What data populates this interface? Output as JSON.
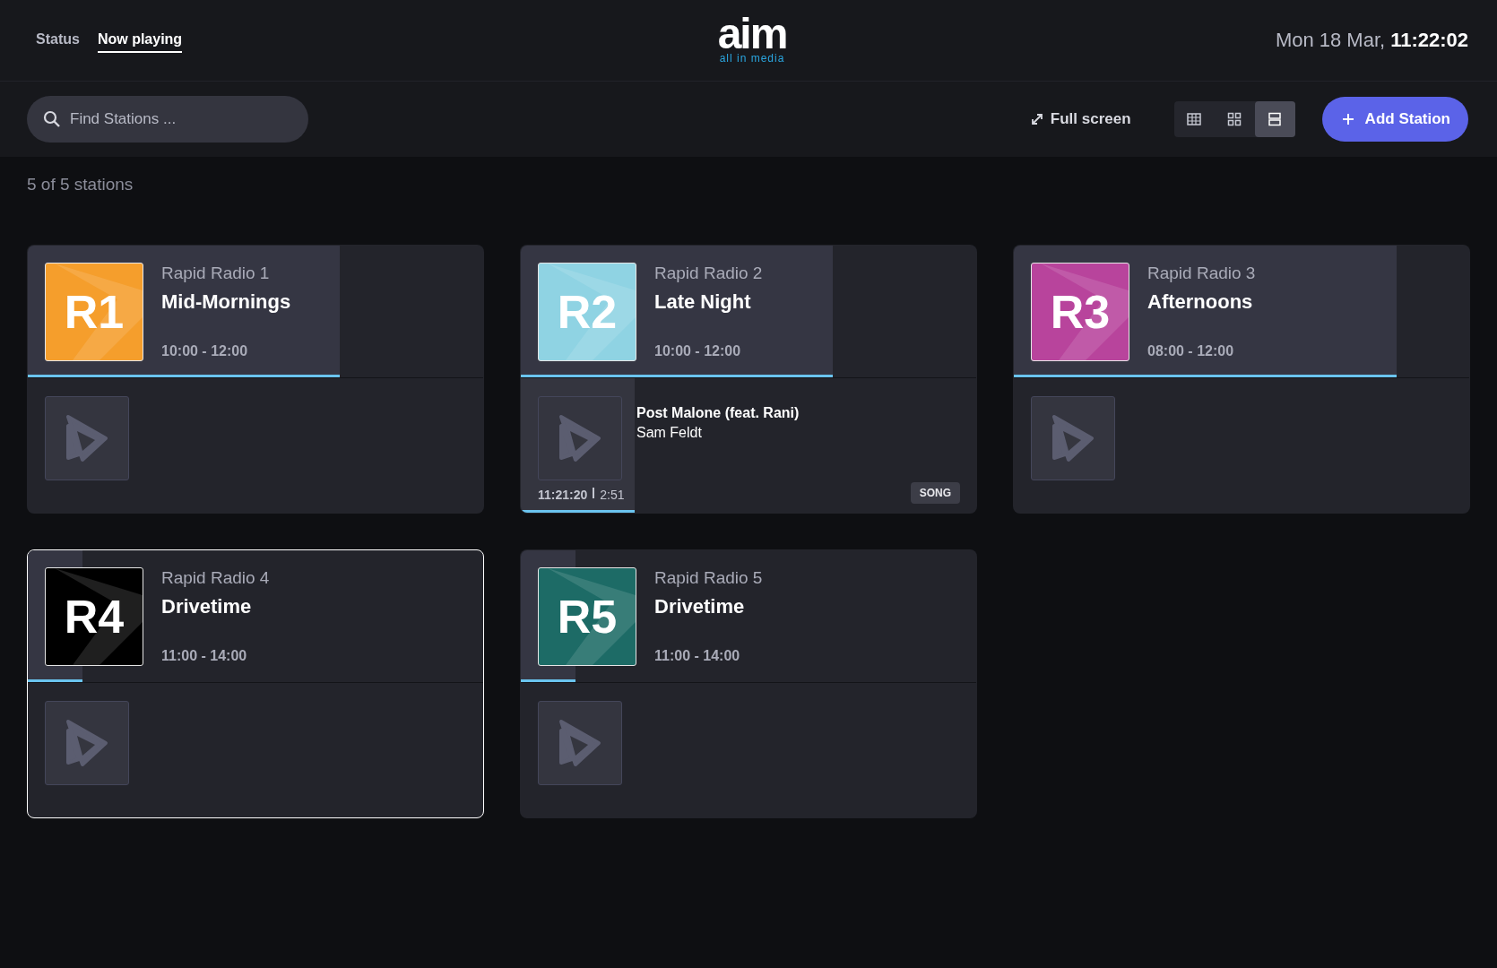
{
  "nav": {
    "tabs": [
      {
        "label": "Status",
        "selected": false
      },
      {
        "label": "Now playing",
        "selected": true
      }
    ]
  },
  "logo": {
    "wordmark": "aim",
    "tagline": "all in media"
  },
  "clock": {
    "date": "Mon 18 Mar,",
    "time": "11:22:02"
  },
  "toolbar": {
    "search": {
      "placeholder": "Find Stations ..."
    },
    "fullscreen": "Full screen",
    "views": [
      {
        "kind": "table",
        "selected": false
      },
      {
        "kind": "grid",
        "selected": false
      },
      {
        "kind": "rows",
        "selected": true
      }
    ],
    "add_button": "Add Station"
  },
  "count": "5 of 5 stations",
  "stations": [
    {
      "name": "Rapid Radio 1",
      "logo_text": "R1",
      "color": "#f59e2c",
      "show": "Mid-Mornings",
      "hours": "10:00 - 12:00",
      "level": 0.685,
      "selected": false
    },
    {
      "name": "Rapid Radio 2",
      "logo_text": "R2",
      "color": "#8fd3e3",
      "show": "Late Night",
      "hours": "10:00 - 12:00",
      "level": 0.685,
      "selected": false,
      "track": {
        "title": "Post Malone (feat. Rani)",
        "artist": "Sam Feldt",
        "start": "11:21:20",
        "duration": "2:51",
        "type": "SONG",
        "level": 0.25
      }
    },
    {
      "name": "Rapid Radio 3",
      "logo_text": "R3",
      "color": "#b8449c",
      "show": "Afternoons",
      "hours": "08:00 - 12:00",
      "level": 0.84,
      "selected": false
    },
    {
      "name": "Rapid Radio 4",
      "logo_text": "R4",
      "color": "#000000",
      "show": "Drivetime",
      "hours": "11:00 - 14:00",
      "level": 0.12,
      "selected": true
    },
    {
      "name": "Rapid Radio 5",
      "logo_text": "R5",
      "color": "#1d6b66",
      "show": "Drivetime",
      "hours": "11:00 - 14:00",
      "level": 0.12,
      "selected": false
    }
  ]
}
